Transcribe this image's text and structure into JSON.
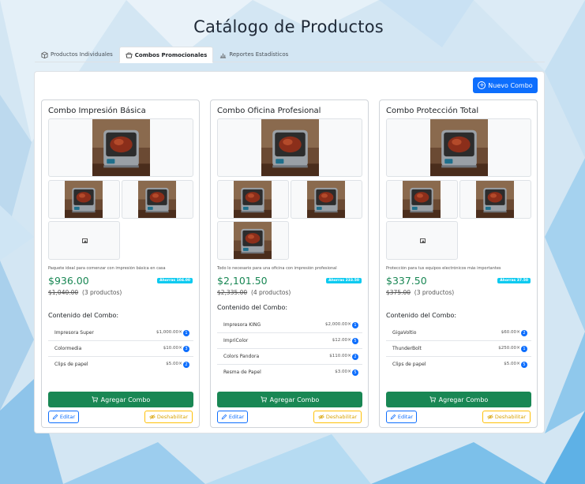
{
  "page_title": "Catálogo de Productos",
  "tabs": [
    {
      "label": "Productos Individuales",
      "icon": "box-icon",
      "active": false
    },
    {
      "label": "Combos Promocionales",
      "icon": "basket-icon",
      "active": true
    },
    {
      "label": "Reportes Estadísticos",
      "icon": "bar-chart-icon",
      "active": false
    }
  ],
  "new_combo_label": "Nuevo Combo",
  "labels": {
    "contents_title": "Contenido del Combo:",
    "add_combo": "Agregar Combo",
    "edit": "Editar",
    "disable": "Deshabilitar"
  },
  "colors": {
    "primary": "#0d6efd",
    "success": "#198754",
    "warning": "#ffc107",
    "info": "#0dcaf0"
  },
  "combos": [
    {
      "name": "Combo Impresión Básica",
      "description": "Paquete ideal para comenzar con impresión básica en casa",
      "price": "$936.00",
      "savings": "Ahorras 104.00",
      "old_price": "$1,040.00",
      "products_count": "(3 productos)",
      "items": [
        {
          "name": "Impresora Super",
          "price": "$1,000.00",
          "times": "×",
          "qty": "1"
        },
        {
          "name": "Colormedia",
          "price": "$10.00",
          "times": "×",
          "qty": "3"
        },
        {
          "name": "Clips de papel",
          "price": "$5.00",
          "times": "×",
          "qty": "2"
        }
      ]
    },
    {
      "name": "Combo Oficina Profesional",
      "description": "Todo lo necesario para una oficina con impresión profesional",
      "price": "$2,101.50",
      "savings": "Ahorras 233.50",
      "old_price": "$2,335.00",
      "products_count": "(4 productos)",
      "items": [
        {
          "name": "Impresora KING",
          "price": "$2,000.00",
          "times": "×",
          "qty": "1"
        },
        {
          "name": "ImpriColor",
          "price": "$12.00",
          "times": "×",
          "qty": "5"
        },
        {
          "name": "Colors Pandora",
          "price": "$110.00",
          "times": "×",
          "qty": "2"
        },
        {
          "name": "Resma de Papel",
          "price": "$3.00",
          "times": "×",
          "qty": "5"
        }
      ]
    },
    {
      "name": "Combo Protección Total",
      "description": "Protección para tus equipos electrónicos más importantes",
      "price": "$337.50",
      "savings": "Ahorras 37.50",
      "old_price": "$375.00",
      "products_count": "(3 productos)",
      "items": [
        {
          "name": "GigaVoltio",
          "price": "$60.00",
          "times": "×",
          "qty": "2"
        },
        {
          "name": "ThunderBolt",
          "price": "$250.00",
          "times": "×",
          "qty": "1"
        },
        {
          "name": "Clips de papel",
          "price": "$5.00",
          "times": "×",
          "qty": "5"
        }
      ]
    }
  ]
}
